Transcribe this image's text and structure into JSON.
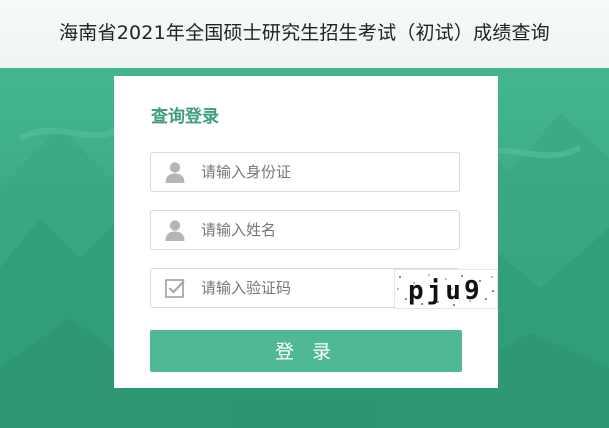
{
  "page": {
    "title": "海南省2021年全国硕士研究生招生考试（初试）成绩查询"
  },
  "login_card": {
    "title": "查询登录",
    "id_field": {
      "placeholder": "请输入身份证",
      "icon": "user-icon"
    },
    "name_field": {
      "placeholder": "请输入姓名",
      "icon": "user-icon"
    },
    "captcha_field": {
      "placeholder": "请输入验证码",
      "icon": "checkbox-icon"
    },
    "captcha_text": "pju9",
    "login_label": "登 录"
  },
  "colors": {
    "accent": "#4fb895",
    "title_green": "#3f9e7a",
    "background": "#3fae8b"
  }
}
